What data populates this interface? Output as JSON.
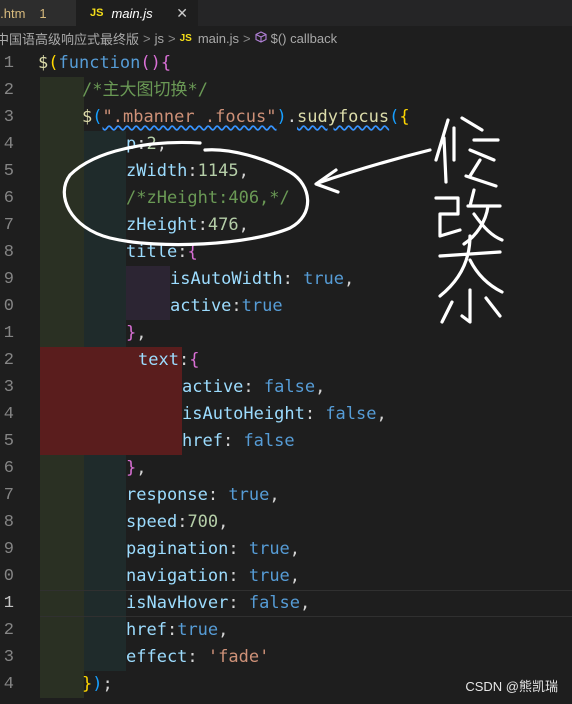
{
  "tabs": [
    {
      "name": "in.htm",
      "modified": "1",
      "active": false
    },
    {
      "badge": "JS",
      "name": "main.js",
      "close": "✕",
      "active": true
    }
  ],
  "breadcrumb": {
    "folder": "中国语高级响应式最终版",
    "sep1": ">",
    "dir": "js",
    "sep2": ">",
    "badge": "JS",
    "file": "main.js",
    "sep3": ">",
    "symbol": "$() callback"
  },
  "line_numbers": [
    "1",
    "2",
    "3",
    "4",
    "5",
    "6",
    "7",
    "8",
    "9",
    "0",
    "1",
    "2",
    "3",
    "4",
    "5",
    "6",
    "7",
    "8",
    "9",
    "0",
    "1",
    "2",
    "3",
    "4"
  ],
  "current_line_index": 20,
  "code_lines": [
    [
      {
        "t": "$",
        "c": "t-fn"
      },
      {
        "t": "(",
        "c": "t-p1"
      },
      {
        "t": "function",
        "c": "t-kw"
      },
      {
        "t": "()",
        "c": "t-p2"
      },
      {
        "t": "{",
        "c": "t-p2"
      }
    ],
    [
      {
        "t": "/*主大图切换*/",
        "c": "t-cm"
      }
    ],
    [
      {
        "t": "$",
        "c": "t-fn"
      },
      {
        "t": "(",
        "c": "t-p3"
      },
      {
        "t": "\".mbanner .focus\"",
        "c": "t-str",
        "sq": true
      },
      {
        "t": ")",
        "c": "t-p3"
      },
      {
        "t": ".",
        "c": "t-def"
      },
      {
        "t": "sudyfocus",
        "c": "t-fn",
        "sq": true
      },
      {
        "t": "(",
        "c": "t-p3"
      },
      {
        "t": "{",
        "c": "t-p1"
      }
    ],
    [
      {
        "t": "p",
        "c": "t-prop"
      },
      {
        "t": ":",
        "c": "t-def"
      },
      {
        "t": "2",
        "c": "t-num"
      },
      {
        "t": ",",
        "c": "t-def"
      }
    ],
    [
      {
        "t": "zWidth",
        "c": "t-prop"
      },
      {
        "t": ":",
        "c": "t-def"
      },
      {
        "t": "1145",
        "c": "t-num"
      },
      {
        "t": ",",
        "c": "t-def"
      }
    ],
    [
      {
        "t": "/*zHeight:406,*/",
        "c": "t-cm"
      }
    ],
    [
      {
        "t": "zHeight",
        "c": "t-prop"
      },
      {
        "t": ":",
        "c": "t-def"
      },
      {
        "t": "476",
        "c": "t-num"
      },
      {
        "t": ",",
        "c": "t-def"
      }
    ],
    [
      {
        "t": "title",
        "c": "t-prop"
      },
      {
        "t": ":",
        "c": "t-def"
      },
      {
        "t": "{",
        "c": "t-p2"
      }
    ],
    [
      {
        "t": "isAutoWidth",
        "c": "t-prop"
      },
      {
        "t": ": ",
        "c": "t-def"
      },
      {
        "t": "true",
        "c": "t-kw"
      },
      {
        "t": ",",
        "c": "t-def"
      }
    ],
    [
      {
        "t": "active",
        "c": "t-prop"
      },
      {
        "t": ":",
        "c": "t-def"
      },
      {
        "t": "true",
        "c": "t-kw"
      }
    ],
    [
      {
        "t": "}",
        "c": "t-p2"
      },
      {
        "t": ",",
        "c": "t-def"
      }
    ],
    [
      {
        "t": "text",
        "c": "t-prop"
      },
      {
        "t": ":",
        "c": "t-def"
      },
      {
        "t": "{",
        "c": "t-p2"
      }
    ],
    [
      {
        "t": "active",
        "c": "t-prop"
      },
      {
        "t": ": ",
        "c": "t-def"
      },
      {
        "t": "false",
        "c": "t-kw"
      },
      {
        "t": ",",
        "c": "t-def"
      }
    ],
    [
      {
        "t": "isAutoHeight",
        "c": "t-prop"
      },
      {
        "t": ": ",
        "c": "t-def"
      },
      {
        "t": "false",
        "c": "t-kw"
      },
      {
        "t": ",",
        "c": "t-def"
      }
    ],
    [
      {
        "t": "href",
        "c": "t-prop"
      },
      {
        "t": ": ",
        "c": "t-def"
      },
      {
        "t": "false",
        "c": "t-kw"
      }
    ],
    [
      {
        "t": "}",
        "c": "t-p2"
      },
      {
        "t": ",",
        "c": "t-def"
      }
    ],
    [
      {
        "t": "response",
        "c": "t-prop"
      },
      {
        "t": ": ",
        "c": "t-def"
      },
      {
        "t": "true",
        "c": "t-kw"
      },
      {
        "t": ",",
        "c": "t-def"
      }
    ],
    [
      {
        "t": "speed",
        "c": "t-prop"
      },
      {
        "t": ":",
        "c": "t-def"
      },
      {
        "t": "700",
        "c": "t-num"
      },
      {
        "t": ",",
        "c": "t-def"
      }
    ],
    [
      {
        "t": "pagination",
        "c": "t-prop"
      },
      {
        "t": ": ",
        "c": "t-def"
      },
      {
        "t": "true",
        "c": "t-kw"
      },
      {
        "t": ",",
        "c": "t-def"
      }
    ],
    [
      {
        "t": "navigation",
        "c": "t-prop"
      },
      {
        "t": ": ",
        "c": "t-def"
      },
      {
        "t": "true",
        "c": "t-kw"
      },
      {
        "t": ",",
        "c": "t-def"
      }
    ],
    [
      {
        "t": "isNavHover",
        "c": "t-prop"
      },
      {
        "t": ": ",
        "c": "t-def"
      },
      {
        "t": "false",
        "c": "t-kw"
      },
      {
        "t": ",",
        "c": "t-def"
      }
    ],
    [
      {
        "t": "href",
        "c": "t-prop"
      },
      {
        "t": ":",
        "c": "t-def"
      },
      {
        "t": "true",
        "c": "t-kw"
      },
      {
        "t": ",",
        "c": "t-def"
      }
    ],
    [
      {
        "t": "effect",
        "c": "t-prop"
      },
      {
        "t": ": ",
        "c": "t-def"
      },
      {
        "t": "'fade'",
        "c": "t-str"
      }
    ],
    [
      {
        "t": "}",
        "c": "t-p1"
      },
      {
        "t": ")",
        "c": "t-p3"
      },
      {
        "t": ";",
        "c": "t-def"
      }
    ]
  ],
  "annotation": {
    "handwritten_text": "修改大小",
    "color": "#ffffff"
  },
  "watermark": "CSDN @熊凯瑞",
  "colors": {
    "background": "#1e1e1e",
    "tab_bar": "#252526",
    "line_numbers": "#858585"
  }
}
